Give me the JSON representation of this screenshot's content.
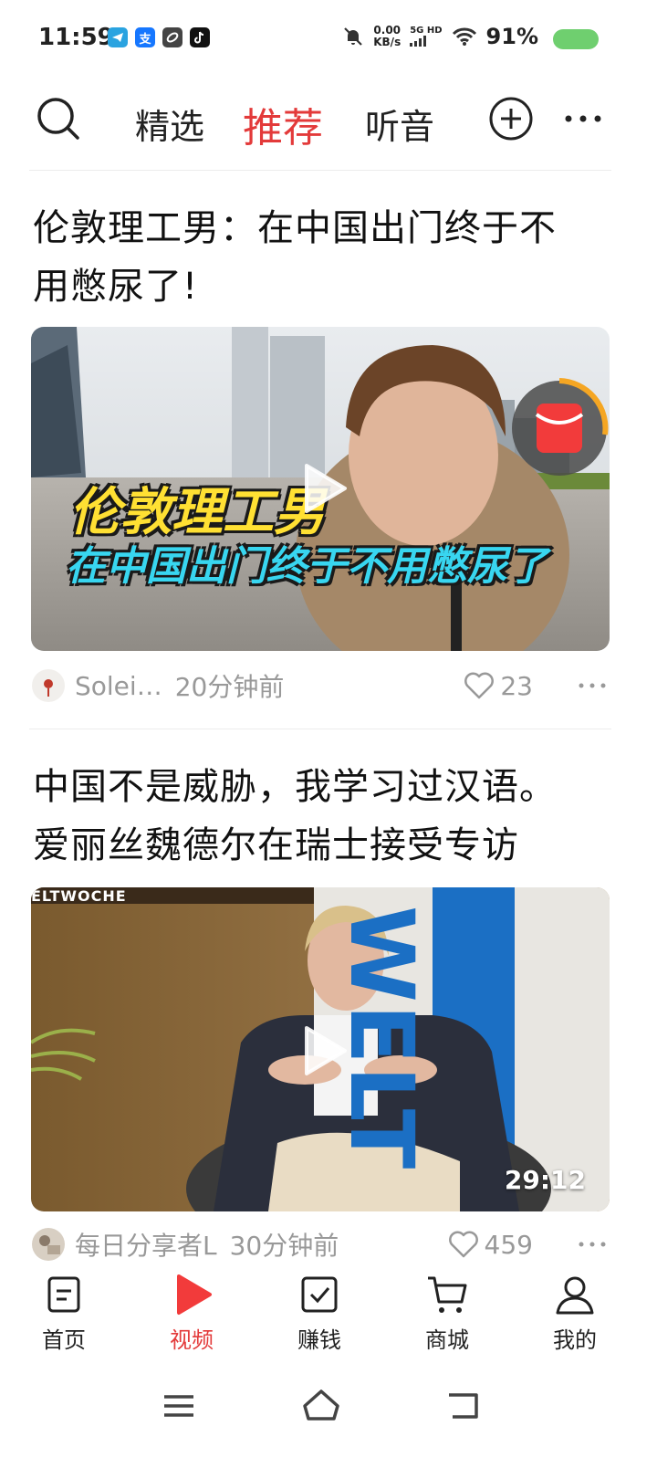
{
  "status_bar": {
    "time": "11:59",
    "net_speed_value": "0.00",
    "net_speed_unit": "KB/s",
    "network": "5G HD",
    "battery_percent": "91%",
    "battery_color": "#6fcf6f",
    "app_icons": [
      "telegram-icon",
      "alipay-icon",
      "link-icon",
      "tiktok-icon"
    ],
    "alipay_glyph": "支"
  },
  "top_nav": {
    "tabs": [
      {
        "label": "精选",
        "active": false
      },
      {
        "label": "推荐",
        "active": true
      },
      {
        "label": "听音",
        "active": false
      }
    ],
    "accent_color": "#e33a3a"
  },
  "feed": [
    {
      "title_line1": "伦敦理工男：在中国出门终于不",
      "title_line2": "用憋尿了!",
      "caption_top": "伦敦理工男",
      "caption_bottom": "在中国出门终于不用憋尿了",
      "author": "Solei…",
      "time": "20分钟前",
      "likes": "23"
    },
    {
      "title_line1": "中国不是威胁，我学习过汉语。",
      "title_line2": "爱丽丝魏德尔在瑞士接受专访",
      "watermark": "ELTWOCHE",
      "sign_text": "WELT",
      "duration": "29:12",
      "author": "每日分享者L",
      "time": "30分钟前",
      "likes": "459"
    }
  ],
  "bottom_nav": {
    "items": [
      {
        "label": "首页",
        "icon": "home-doc-icon",
        "active": false
      },
      {
        "label": "视频",
        "icon": "video-play-icon",
        "active": true
      },
      {
        "label": "赚钱",
        "icon": "check-box-icon",
        "active": false
      },
      {
        "label": "商城",
        "icon": "cart-icon",
        "active": false
      },
      {
        "label": "我的",
        "icon": "person-icon",
        "active": false
      }
    ]
  }
}
